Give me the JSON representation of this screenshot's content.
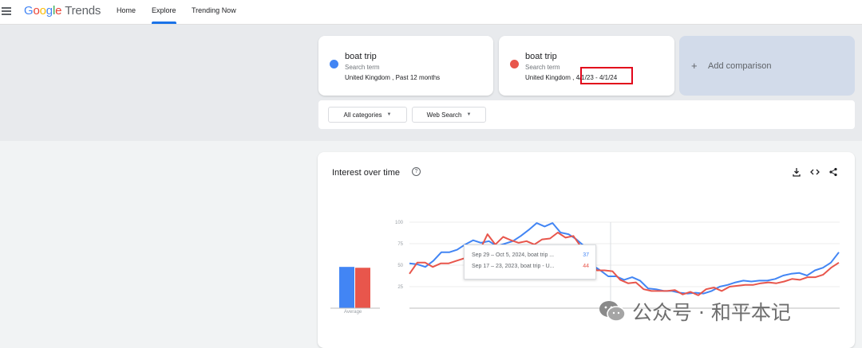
{
  "header": {
    "logo_google": [
      "G",
      "o",
      "o",
      "g",
      "l",
      "e"
    ],
    "logo_trends": "Trends",
    "nav": [
      {
        "label": "Home",
        "active": false
      },
      {
        "label": "Explore",
        "active": true
      },
      {
        "label": "Trending Now",
        "active": false
      }
    ]
  },
  "terms": [
    {
      "name": "boat trip",
      "sublabel": "Search term",
      "meta": "United Kingdom , Past 12 months",
      "color": "#4285f4"
    },
    {
      "name": "boat trip",
      "sublabel": "Search term",
      "meta": "United Kingdom , 4/1/23 - 4/1/24",
      "color": "#ea5a50"
    }
  ],
  "add_comparison": {
    "icon": "+",
    "label": "Add comparison"
  },
  "filters": [
    {
      "label": "All categories"
    },
    {
      "label": "Web Search"
    }
  ],
  "chart_section": {
    "title": "Interest over time",
    "help_icon": "?",
    "tools": [
      "download-icon",
      "embed-icon",
      "share-icon"
    ]
  },
  "chart_data": {
    "type": "line",
    "title": "",
    "ylim": [
      0,
      100
    ],
    "yticks": [
      "100",
      "75",
      "50",
      "25"
    ],
    "average_label": "Average",
    "averages": [
      48,
      47
    ],
    "series": [
      {
        "color": "#4285f4",
        "values": [
          52,
          51,
          48,
          55,
          65,
          65,
          68,
          74,
          79,
          76,
          78,
          72,
          75,
          78,
          84,
          91,
          99,
          95,
          99,
          88,
          86,
          80,
          72,
          50,
          44,
          37,
          37,
          33,
          36,
          32,
          23,
          22,
          20,
          20,
          18,
          17,
          18,
          17,
          20,
          25,
          27,
          30,
          32,
          31,
          32,
          32,
          34,
          38,
          40,
          41,
          38,
          44,
          47,
          53,
          65
        ]
      },
      {
        "color": "#e8564c",
        "values": [
          40,
          53,
          53,
          48,
          52,
          52,
          55,
          58,
          64,
          67,
          86,
          74,
          83,
          79,
          76,
          78,
          74,
          80,
          81,
          88,
          82,
          84,
          71,
          55,
          44,
          44,
          43,
          33,
          29,
          30,
          22,
          20,
          20,
          20,
          21,
          16,
          19,
          15,
          22,
          24,
          20,
          25,
          26,
          27,
          27,
          29,
          30,
          29,
          31,
          34,
          33,
          36,
          36,
          39,
          47,
          53
        ]
      }
    ],
    "tooltip": [
      {
        "label": "Sep 29 – Oct 5, 2024, boat trip ...",
        "value": "37",
        "color": "#4285f4"
      },
      {
        "label": "Sep 17 – 23, 2023, boat trip - U...",
        "value": "44",
        "color": "#e8564c"
      }
    ]
  },
  "watermark": {
    "text": "公众号 · 和平本记"
  }
}
